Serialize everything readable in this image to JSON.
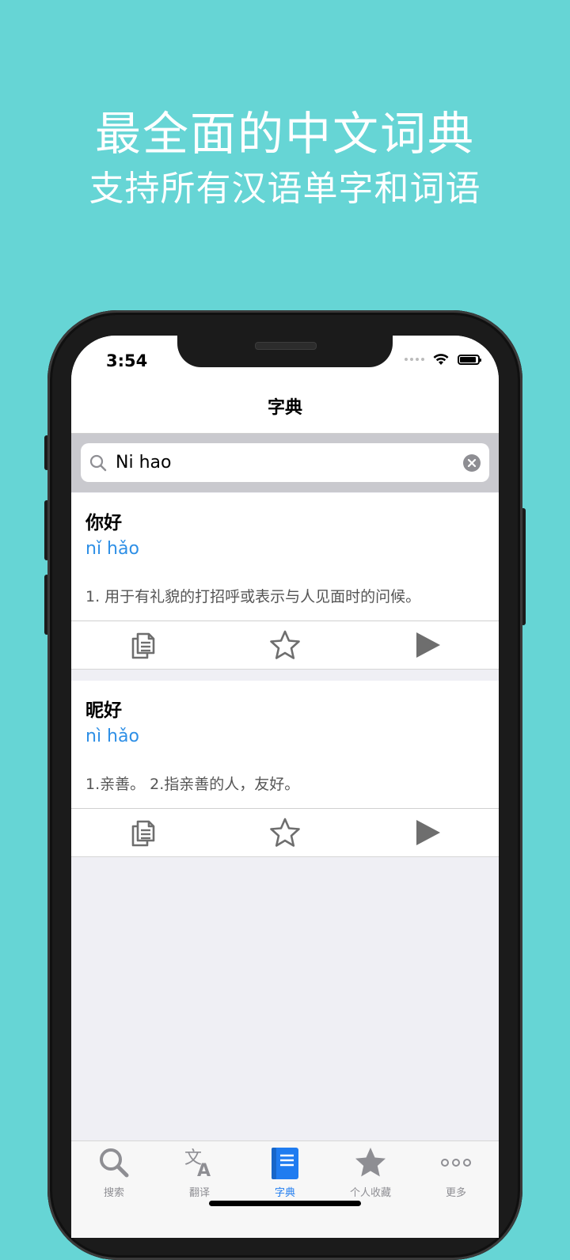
{
  "promo": {
    "line1": "最全面的中文词典",
    "line2": "支持所有汉语单字和词语"
  },
  "status": {
    "time": "3:54"
  },
  "nav": {
    "title": "字典"
  },
  "search": {
    "value": "Ni hao"
  },
  "entries": [
    {
      "word": "你好",
      "pinyin": "nǐ hǎo",
      "definition": "1. 用于有礼貌的打招呼或表示与人见面时的问候。"
    },
    {
      "word": "昵好",
      "pinyin": "nì hǎo",
      "definition": "1.亲善。 2.指亲善的人，友好。"
    }
  ],
  "tabs": [
    {
      "label": "搜索",
      "icon": "search-icon"
    },
    {
      "label": "翻译",
      "icon": "translate-icon"
    },
    {
      "label": "字典",
      "icon": "book-icon",
      "active": true
    },
    {
      "label": "个人收藏",
      "icon": "star-icon"
    },
    {
      "label": "更多",
      "icon": "more-icon"
    }
  ],
  "colors": {
    "background": "#66d5d5",
    "accent": "#1f7cf0",
    "pinyin": "#2e8fe6",
    "icon_gray": "#8e8e93"
  }
}
